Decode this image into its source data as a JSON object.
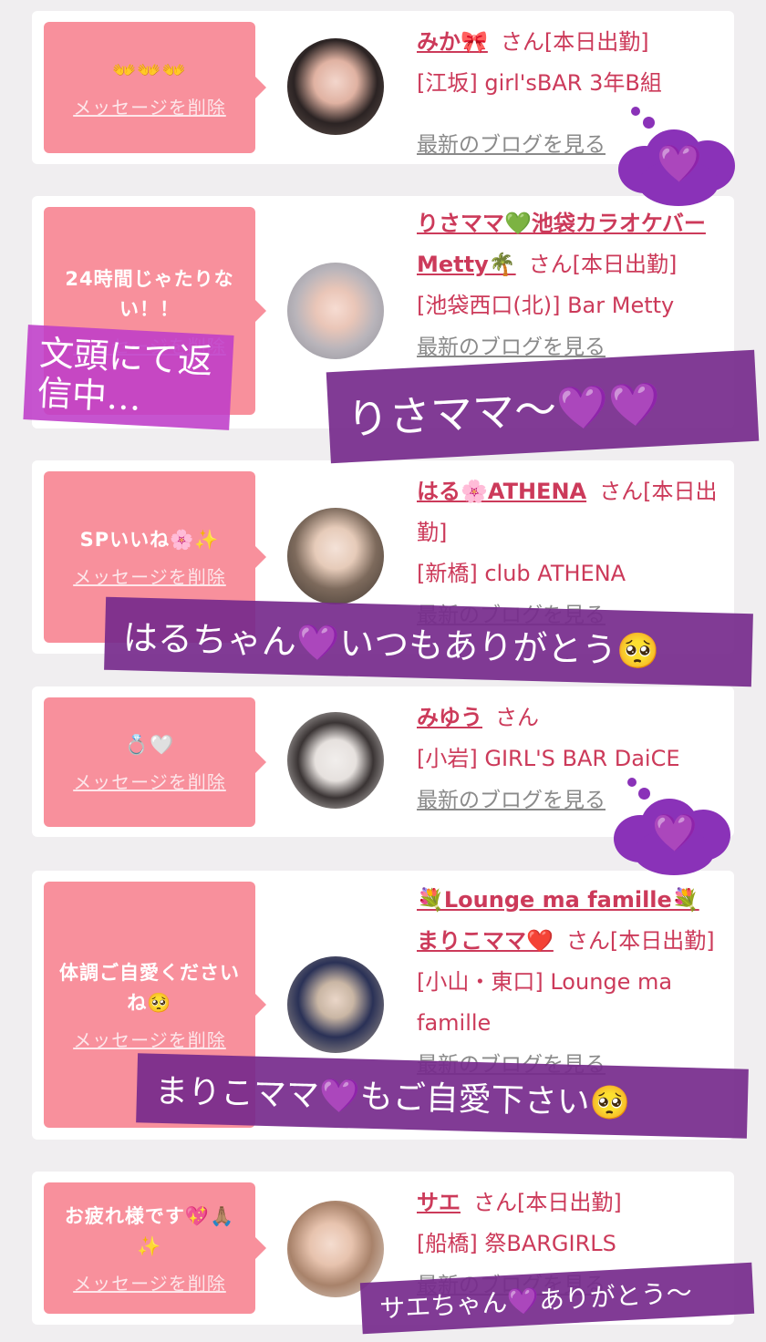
{
  "delete_label": "メッセージを削除",
  "blog_label": "最新のブログを見る",
  "san": "さん",
  "cards": [
    {
      "message": "👐👐👐",
      "name": "みか🎀",
      "status": "[本日出勤]",
      "area_shop": "[江坂] girl'sBAR 3年B組"
    },
    {
      "message": "24時間じゃたりない！！",
      "name": "りさママ💚池袋カラオケバーMetty🌴",
      "status": "[本日出勤]",
      "area_shop": "[池袋西口(北)] Bar Metty"
    },
    {
      "message": "SPいいね🌸✨",
      "name": "はる🌸ATHENA",
      "status": "[本日出勤]",
      "area_shop": "[新橋] club ATHENA"
    },
    {
      "message": "💍🤍",
      "name": "みゆう",
      "status": "",
      "area_shop": "[小岩] GIRL'S BAR DaiCE"
    },
    {
      "message": "体調ご自愛くださいね🥺",
      "name": "💐Lounge ma famille💐まりこママ❤️",
      "status": "[本日出勤]",
      "area_shop": "[小山・東口] Lounge ma famille"
    },
    {
      "message": "お疲れ様です💖🙏🏽✨",
      "name": "サエ",
      "status": "[本日出勤]",
      "area_shop": "[船橋] 祭BARGIRLS"
    }
  ],
  "overlays": {
    "replying": "文頭にて返信中…",
    "risa": "りさママ〜💜💜",
    "haru": "はるちゃん💜いつもありがとう🥺",
    "mariko": "まりこママ💜もご自愛下さい🥺",
    "sae": "サエちゃん💜ありがとう〜"
  },
  "heart_icon": "💜",
  "colors": {
    "bubble": "#f8909c",
    "name": "#cc3a5a",
    "overlay": "#762a8c",
    "cloud": "#8a32b8"
  }
}
